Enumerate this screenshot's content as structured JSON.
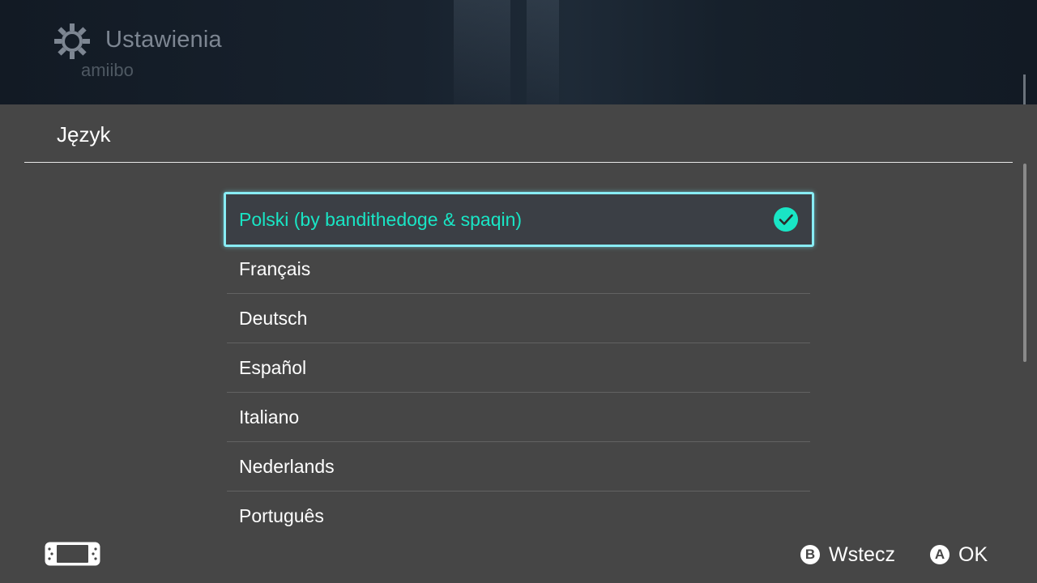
{
  "background": {
    "title": "Ustawienia",
    "icon": "gear-icon",
    "partial_text": "amiibo"
  },
  "dialog": {
    "title": "Język",
    "items": [
      {
        "label": "Polski (by bandithedoge & spaqin)",
        "selected": true
      },
      {
        "label": "Français",
        "selected": false
      },
      {
        "label": "Deutsch",
        "selected": false
      },
      {
        "label": "Español",
        "selected": false
      },
      {
        "label": "Italiano",
        "selected": false
      },
      {
        "label": "Nederlands",
        "selected": false
      },
      {
        "label": "Português",
        "selected": false
      }
    ]
  },
  "footer": {
    "console_icon": "handheld-console-icon",
    "back": {
      "key": "B",
      "label": "Wstecz"
    },
    "ok": {
      "key": "A",
      "label": "OK"
    }
  },
  "colors": {
    "accent": "#19e5c5",
    "focus": "#88ecf4",
    "panel": "#464646"
  }
}
